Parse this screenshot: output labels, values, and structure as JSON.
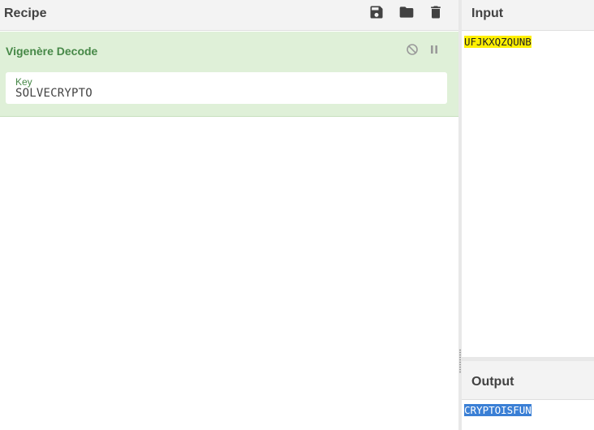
{
  "recipe": {
    "title": "Recipe",
    "toolbar": {
      "save_icon": "save-icon",
      "load_icon": "folder-icon",
      "clear_icon": "trash-icon"
    },
    "operation": {
      "name": "Vigenère Decode",
      "disable_icon": "disable-icon",
      "pause_icon": "pause-icon",
      "key_label": "Key",
      "key_value": "SOLVECRYPTO"
    }
  },
  "input": {
    "title": "Input",
    "text": "UFJKXQZQUNB"
  },
  "output": {
    "title": "Output",
    "text": "CRYPTOISFUN"
  },
  "colors": {
    "operation_bg": "#dff0d8",
    "operation_title": "#468847",
    "input_highlight": "#fff000",
    "output_highlight": "#3a7fd5"
  }
}
